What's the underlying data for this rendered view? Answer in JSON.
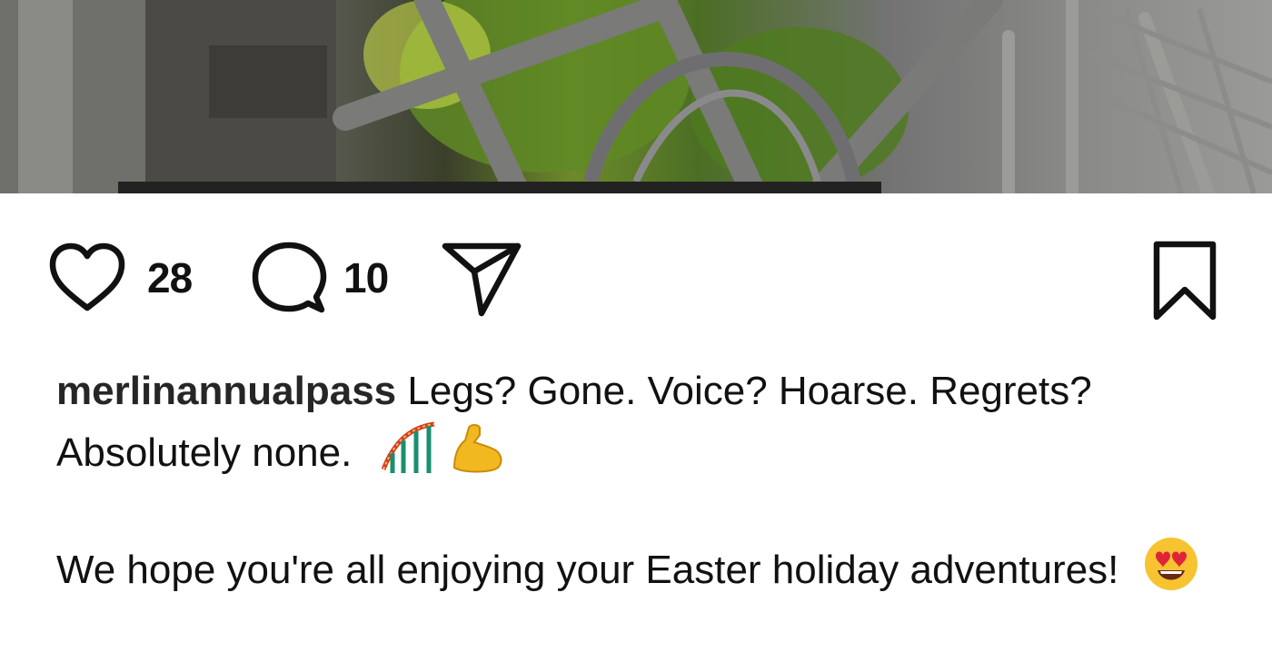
{
  "post": {
    "image_alt": "Roller coaster steel structure among green trees",
    "likes_count": "28",
    "comments_count": "10"
  },
  "actions": {
    "like_icon": "heart-outline-icon",
    "comment_icon": "speech-bubble-icon",
    "share_icon": "paper-plane-icon",
    "save_icon": "bookmark-outline-icon"
  },
  "caption": {
    "username": "merlinannualpass",
    "line1_text": "Legs? Gone. Voice? Hoarse. Regrets? Absolutely none.",
    "line1_emoji": [
      "roller-coaster-emoji",
      "flexed-biceps-emoji"
    ],
    "line2_text": "We hope you're all enjoying your Easter holiday adventures!",
    "line2_emoji": [
      "heart-eyes-emoji"
    ]
  },
  "colors": {
    "background": "#ffffff",
    "text": "#111111",
    "username": "#262626"
  }
}
